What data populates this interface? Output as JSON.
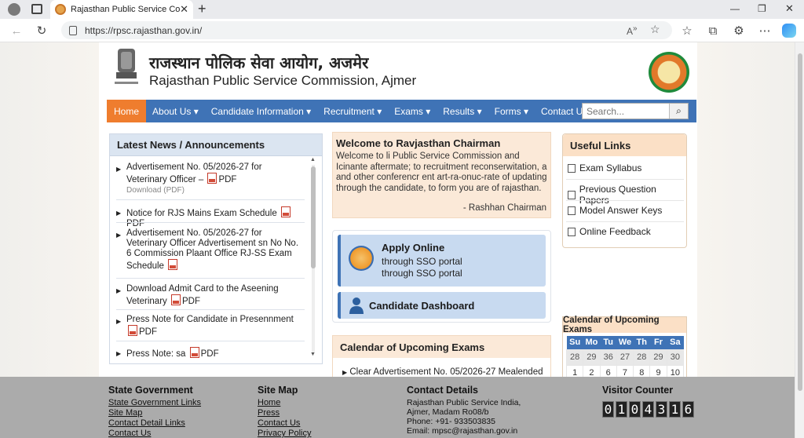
{
  "browser": {
    "tab_title": "Rajasthan Public Service Comm",
    "url": "https://rpsc.rajasthan.gov.in/"
  },
  "header": {
    "title_hindi": "राजस्थान पोलिक सेवा आयोग, अजमेर",
    "title_english": "Rajasthan Public Service Commission, Ajmer"
  },
  "nav": {
    "items": [
      "Home",
      "About Us ▾",
      "Candidate Information ▾",
      "Recruitment ▾",
      "Exams ▾",
      "Results ▾",
      "Forms ▾",
      "Contact Us"
    ],
    "search_placeholder": "Search..."
  },
  "news": {
    "title": "Latest News / Announcements",
    "items": [
      {
        "text": "Advertisement No. 05/2026-27 for Veterinary Officer –",
        "pdf": "PDF",
        "sub": "Download (PDF)"
      },
      {
        "text": "Notice for RJS Mains Exam Schedule",
        "pdf": "PDF"
      },
      {
        "text": "Advertisement No. 05/2026-27 for Veterinary Officer Advertisement sn No No. 6 Commission Plaant Office RJ-SS Exam Schedule"
      },
      {
        "text": "Download Admit Card to the Aseening Veterinary",
        "pdf": "PDF"
      },
      {
        "text": "Press Note for Candidate in Presennment",
        "pdf": "PDF"
      },
      {
        "text": "Press Note: sa",
        "pdf": "PDF"
      }
    ]
  },
  "welcome": {
    "title": "Welcome to Ravjasthan Chairman",
    "body": "Welcome to li Public Service Commission and Icinante aftermate; to recruitment reconserwitation, a and other conferencr ent art-ra-onuc-rate of updating through the candidate, to form you are of rajasthan.",
    "signature": "- Rashhan Chairman"
  },
  "apply": {
    "title": "Apply Online",
    "line1": "through SSO portal",
    "line2": "through SSO portal"
  },
  "dashboard": {
    "title": "Candidate Dashboard"
  },
  "calendar_mid": {
    "title": "Calendar of Upcoming Exams",
    "row": "Clear Advertisement No. 05/2026-27 Mealended"
  },
  "useful": {
    "title": "Useful Links",
    "items": [
      "Exam Syllabus",
      "Previous Question Papers",
      "Model Answer Keys",
      "Online Feedback"
    ]
  },
  "calendar_side": {
    "title": "Calendar of Upcoming Exams",
    "days": [
      "Su",
      "Mo",
      "Tu",
      "We",
      "Th",
      "Fr",
      "Sa"
    ],
    "row1": [
      "28",
      "29",
      "36",
      "27",
      "28",
      "29",
      "30"
    ],
    "row2": [
      "1",
      "2",
      "6",
      "7",
      "8",
      "9",
      "10"
    ]
  },
  "footer": {
    "state_gov": {
      "title": "State Government",
      "links": [
        "State Government Links",
        "Site Map",
        "Contact Detail Links",
        "Contact Us"
      ]
    },
    "site_map": {
      "title": "Site Map",
      "links": [
        "Home",
        "Press",
        "Contact Us",
        "Privacy Policy"
      ]
    },
    "contact": {
      "title": "Contact Details",
      "lines": [
        "Rajasthan Public Service India,",
        "Ajmer, Madam Ro08/b",
        "Phone: +91- 933503835",
        "Email: mpsc@rajasthan.gov.in"
      ]
    },
    "visitor": {
      "title": "Visitor Counter",
      "digits": [
        "0",
        "1",
        "0",
        "4",
        "3",
        "1",
        "6"
      ]
    }
  }
}
